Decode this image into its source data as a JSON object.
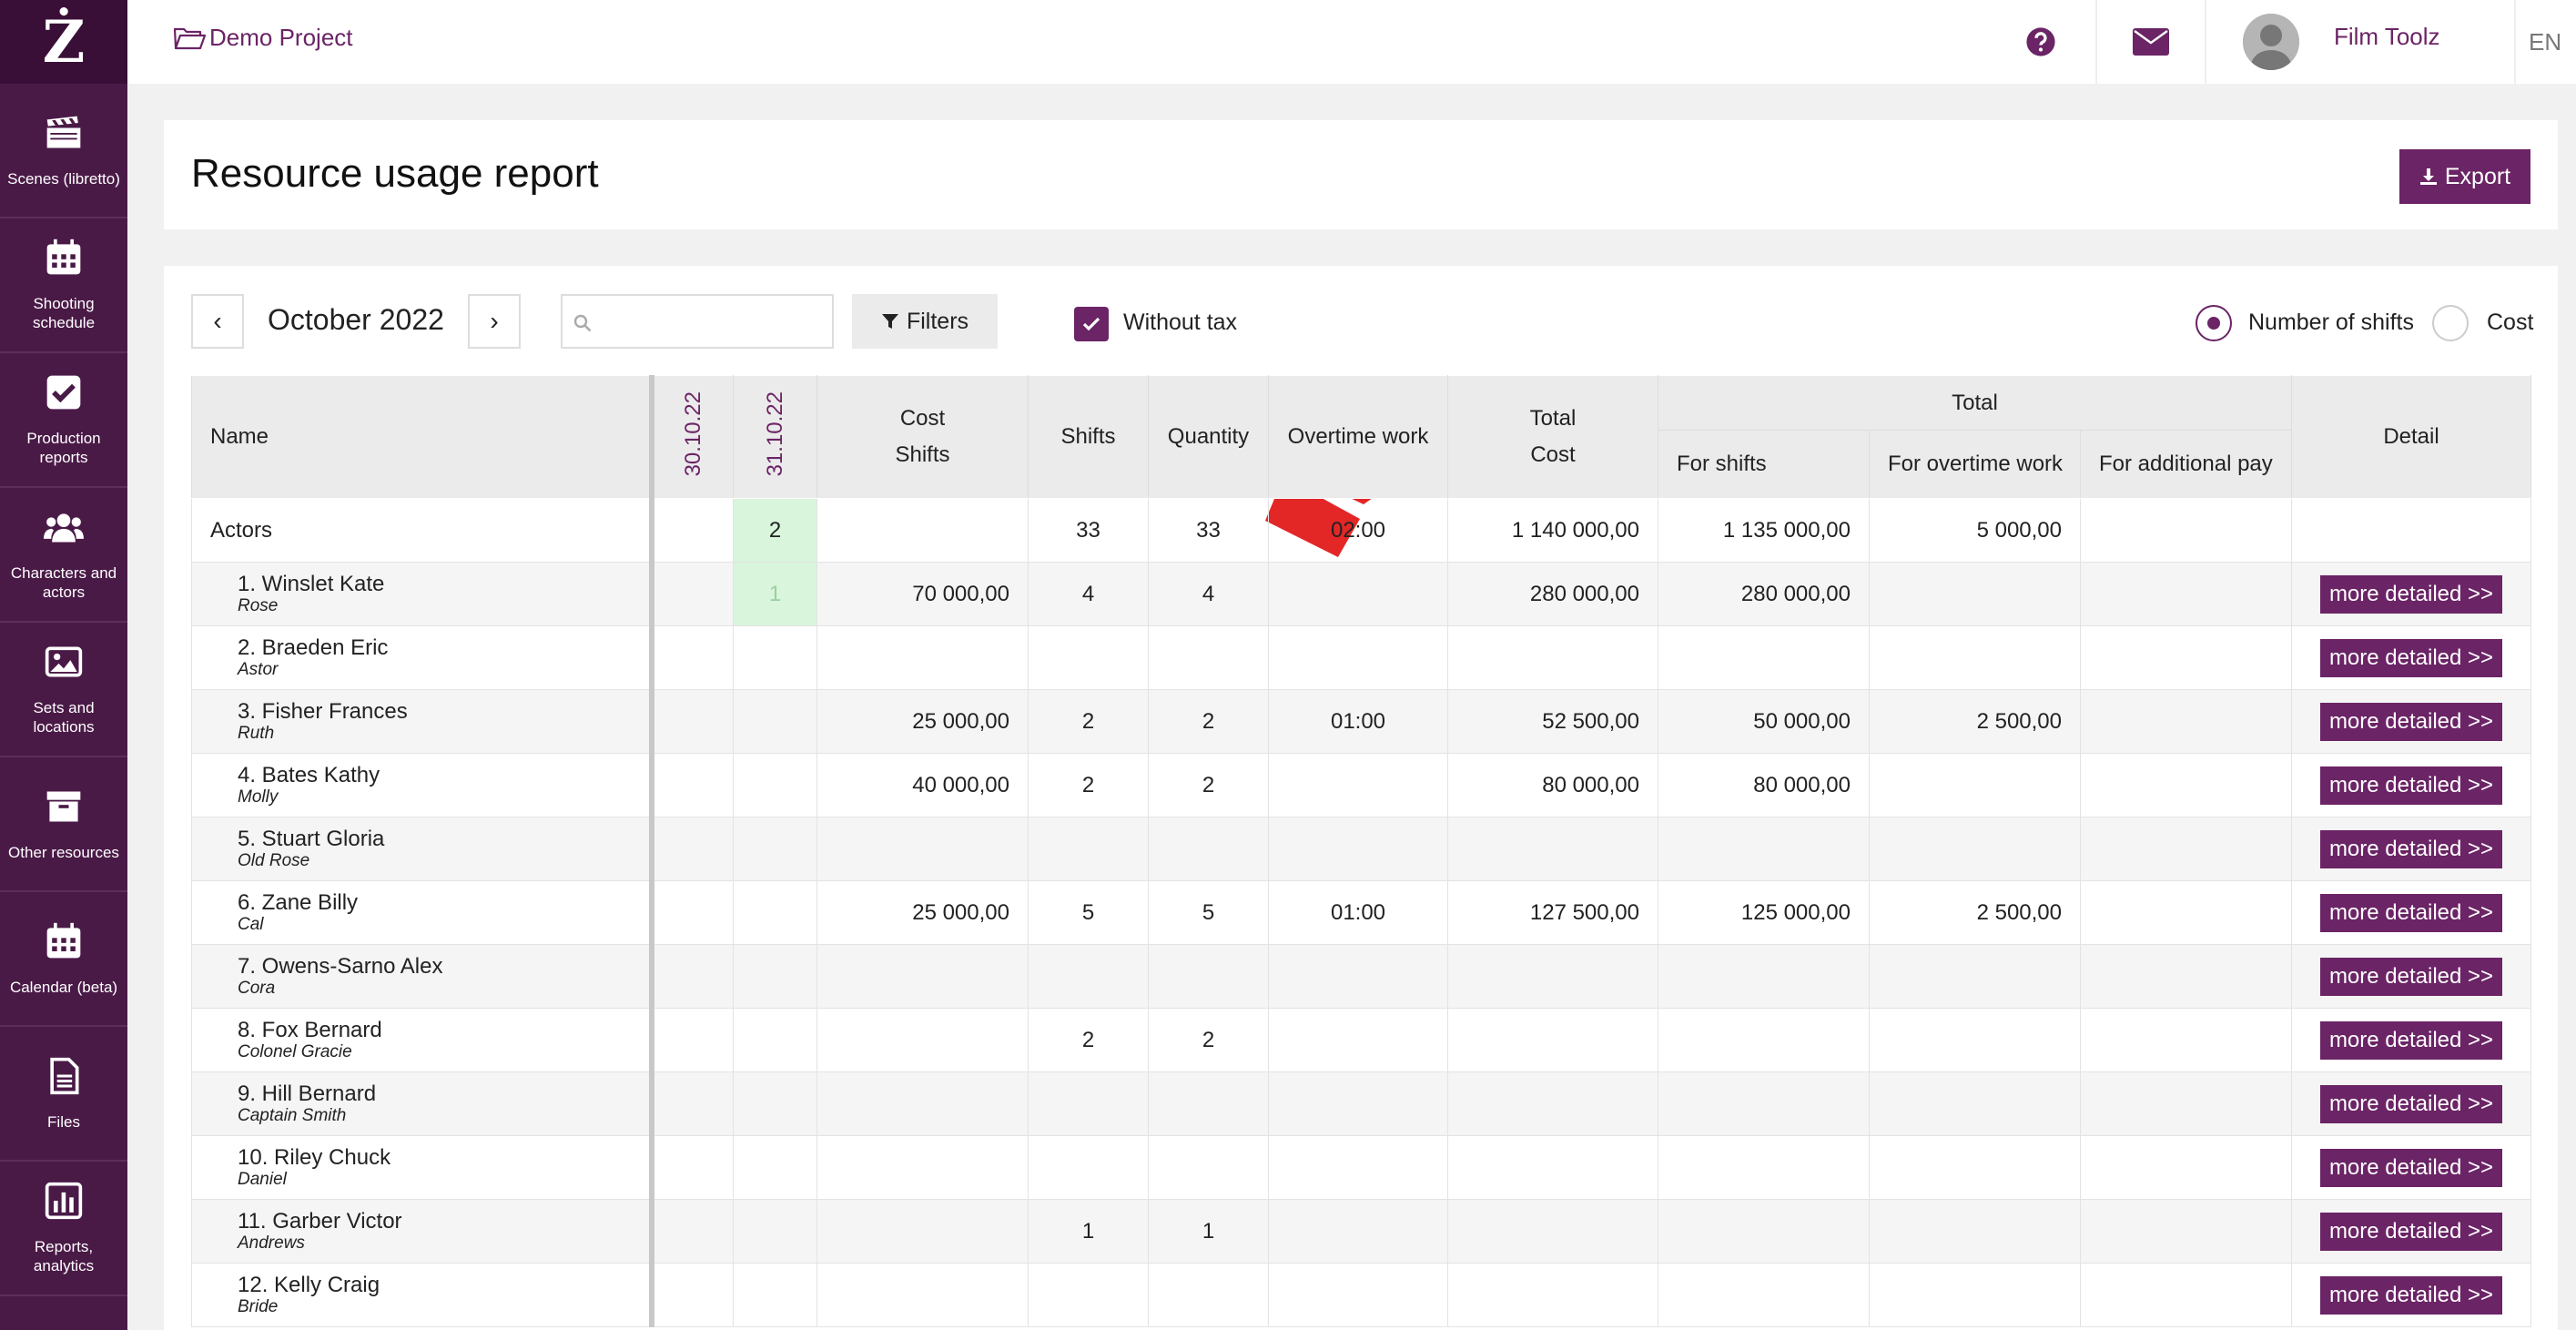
{
  "app": {
    "logo_text": "Ż"
  },
  "sidebar": {
    "items": [
      {
        "label": "Scenes (libretto)",
        "icon": "clapperboard-icon"
      },
      {
        "label": "Shooting schedule",
        "icon": "calendar-icon"
      },
      {
        "label": "Production reports",
        "icon": "checkbox-icon"
      },
      {
        "label": "Characters and actors",
        "icon": "users-icon"
      },
      {
        "label": "Sets and locations",
        "icon": "image-icon"
      },
      {
        "label": "Other resources",
        "icon": "archive-icon"
      },
      {
        "label": "Calendar (beta)",
        "icon": "calendar-icon"
      },
      {
        "label": "Files",
        "icon": "file-icon"
      },
      {
        "label": "Reports, analytics",
        "icon": "chart-icon"
      }
    ]
  },
  "topbar": {
    "project_name": "Demo Project",
    "user_name": "Film Toolz",
    "language": "EN"
  },
  "header": {
    "title": "Resource usage report",
    "export_label": "Export"
  },
  "toolbar": {
    "prev_label": "‹",
    "next_label": "›",
    "month": "October 2022",
    "search_placeholder": "",
    "filters_label": "Filters",
    "without_tax_label": "Without tax",
    "without_tax_checked": true,
    "mode_options": [
      "Number of shifts",
      "Cost"
    ],
    "mode_selected": "Number of shifts"
  },
  "table": {
    "headers": {
      "name": "Name",
      "dates": [
        "30.10.22",
        "31.10.22"
      ],
      "cost_line1": "Cost",
      "cost_line2": "Shifts",
      "shifts": "Shifts",
      "quantity": "Quantity",
      "overtime": "Overtime work",
      "total_cost_line1": "Total",
      "total_cost_line2": "Cost",
      "total_group": "Total",
      "for_shifts": "For shifts",
      "for_overtime": "For overtime work",
      "for_additional": "For additional pay",
      "detail": "Detail"
    },
    "group": {
      "name": "Actors",
      "d1": "",
      "d2": "2",
      "cost": "",
      "shifts": "33",
      "quantity": "33",
      "overtime": "02:00",
      "total_cost": "1 140 000,00",
      "for_shifts": "1 135 000,00",
      "for_overtime": "5 000,00",
      "for_additional": ""
    },
    "detail_label": "more detailed >>",
    "rows": [
      {
        "name": "1. Winslet Kate",
        "role": "Rose",
        "d1": "",
        "d2": "1",
        "cost": "70 000,00",
        "shifts": "4",
        "quantity": "4",
        "overtime": "",
        "total_cost": "280 000,00",
        "for_shifts": "280 000,00",
        "for_overtime": "",
        "for_additional": ""
      },
      {
        "name": "2. Braeden Eric",
        "role": "Astor",
        "d1": "",
        "d2": "",
        "cost": "",
        "shifts": "",
        "quantity": "",
        "overtime": "",
        "total_cost": "",
        "for_shifts": "",
        "for_overtime": "",
        "for_additional": ""
      },
      {
        "name": "3. Fisher Frances",
        "role": "Ruth",
        "d1": "",
        "d2": "",
        "cost": "25 000,00",
        "shifts": "2",
        "quantity": "2",
        "overtime": "01:00",
        "total_cost": "52 500,00",
        "for_shifts": "50 000,00",
        "for_overtime": "2 500,00",
        "for_additional": ""
      },
      {
        "name": "4. Bates Kathy",
        "role": "Molly",
        "d1": "",
        "d2": "",
        "cost": "40 000,00",
        "shifts": "2",
        "quantity": "2",
        "overtime": "",
        "total_cost": "80 000,00",
        "for_shifts": "80 000,00",
        "for_overtime": "",
        "for_additional": ""
      },
      {
        "name": "5. Stuart Gloria",
        "role": "Old Rose",
        "d1": "",
        "d2": "",
        "cost": "",
        "shifts": "",
        "quantity": "",
        "overtime": "",
        "total_cost": "",
        "for_shifts": "",
        "for_overtime": "",
        "for_additional": ""
      },
      {
        "name": "6. Zane Billy",
        "role": "Cal",
        "d1": "",
        "d2": "",
        "cost": "25 000,00",
        "shifts": "5",
        "quantity": "5",
        "overtime": "01:00",
        "total_cost": "127 500,00",
        "for_shifts": "125 000,00",
        "for_overtime": "2 500,00",
        "for_additional": ""
      },
      {
        "name": "7. Owens-Sarno Alex",
        "role": "Cora",
        "d1": "",
        "d2": "",
        "cost": "",
        "shifts": "",
        "quantity": "",
        "overtime": "",
        "total_cost": "",
        "for_shifts": "",
        "for_overtime": "",
        "for_additional": ""
      },
      {
        "name": "8. Fox Bernard",
        "role": "Colonel Gracie",
        "d1": "",
        "d2": "",
        "cost": "",
        "shifts": "2",
        "quantity": "2",
        "overtime": "",
        "total_cost": "",
        "for_shifts": "",
        "for_overtime": "",
        "for_additional": ""
      },
      {
        "name": "9. Hill Bernard",
        "role": "Captain Smith",
        "d1": "",
        "d2": "",
        "cost": "",
        "shifts": "",
        "quantity": "",
        "overtime": "",
        "total_cost": "",
        "for_shifts": "",
        "for_overtime": "",
        "for_additional": ""
      },
      {
        "name": "10. Riley Chuck",
        "role": "Daniel",
        "d1": "",
        "d2": "",
        "cost": "",
        "shifts": "",
        "quantity": "",
        "overtime": "",
        "total_cost": "",
        "for_shifts": "",
        "for_overtime": "",
        "for_additional": ""
      },
      {
        "name": "11. Garber Victor",
        "role": "Andrews",
        "d1": "",
        "d2": "",
        "cost": "",
        "shifts": "1",
        "quantity": "1",
        "overtime": "",
        "total_cost": "",
        "for_shifts": "",
        "for_overtime": "",
        "for_additional": ""
      },
      {
        "name": "12. Kelly Craig",
        "role": "Bride",
        "d1": "",
        "d2": "",
        "cost": "",
        "shifts": "",
        "quantity": "",
        "overtime": "",
        "total_cost": "",
        "for_shifts": "",
        "for_overtime": "",
        "for_additional": ""
      }
    ]
  },
  "colors": {
    "brand": "#6b2466",
    "sidebar": "#4a1a47",
    "highlight_cell": "#d9f5dc",
    "marker": "#e32626"
  }
}
